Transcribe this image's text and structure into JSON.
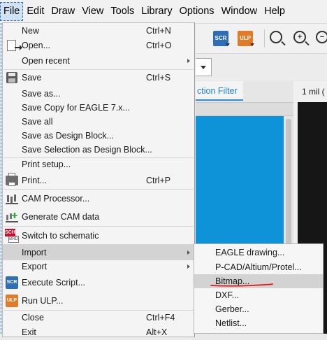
{
  "menubar": {
    "items": [
      "File",
      "Edit",
      "Draw",
      "View",
      "Tools",
      "Library",
      "Options",
      "Window",
      "Help"
    ],
    "active_index": 0
  },
  "toolbar": {
    "scr_icon_label": "SCR",
    "ulp_icon_label": "ULP",
    "zoom_icons": [
      "zoom-fit-icon",
      "zoom-in-icon",
      "zoom-out-icon"
    ]
  },
  "side_panel": {
    "tab_label": "ction Filter",
    "coordinate_readout": "1 mil ("
  },
  "file_menu": {
    "items": [
      {
        "label": "New",
        "shortcut": "Ctrl+N",
        "icon": ""
      },
      {
        "label": "Open...",
        "shortcut": "Ctrl+O",
        "icon": "open-file-icon"
      },
      {
        "label": "Open recent",
        "shortcut": "",
        "icon": "",
        "submenu": true
      },
      {
        "label": "Save",
        "shortcut": "Ctrl+S",
        "icon": "save-icon"
      },
      {
        "label": "Save as...",
        "shortcut": "",
        "icon": ""
      },
      {
        "label": "Save Copy for EAGLE 7.x...",
        "shortcut": "",
        "icon": ""
      },
      {
        "label": "Save all",
        "shortcut": "",
        "icon": ""
      },
      {
        "label": "Save as Design Block...",
        "shortcut": "",
        "icon": ""
      },
      {
        "label": "Save Selection as Design Block...",
        "shortcut": "",
        "icon": ""
      },
      {
        "label": "Print setup...",
        "shortcut": "",
        "icon": ""
      },
      {
        "label": "Print...",
        "shortcut": "Ctrl+P",
        "icon": "printer-icon"
      },
      {
        "label": "CAM Processor...",
        "shortcut": "",
        "icon": "cam-processor-icon"
      },
      {
        "label": "Generate CAM data",
        "shortcut": "",
        "icon": "generate-cam-icon"
      },
      {
        "label": "Switch to schematic",
        "shortcut": "",
        "icon": "sch-brd-icon"
      },
      {
        "label": "Import",
        "shortcut": "",
        "icon": "",
        "submenu": true
      },
      {
        "label": "Export",
        "shortcut": "",
        "icon": "",
        "submenu": true
      },
      {
        "label": "Execute Script...",
        "shortcut": "",
        "icon": "scr-icon"
      },
      {
        "label": "Run ULP...",
        "shortcut": "",
        "icon": "ulp-icon"
      },
      {
        "label": "Close",
        "shortcut": "Ctrl+F4",
        "icon": ""
      },
      {
        "label": "Exit",
        "shortcut": "Alt+X",
        "icon": ""
      }
    ],
    "icon_text": {
      "sch": "SCH",
      "brd": "BRD",
      "scr": "SCR",
      "ulp": "ULP"
    }
  },
  "import_submenu": {
    "items": [
      "EAGLE drawing...",
      "P-CAD/Altium/Protel...",
      "Bitmap...",
      "DXF...",
      "Gerber...",
      "Netlist..."
    ],
    "highlighted": "Bitmap..."
  },
  "colors": {
    "menu_bg": "#f4f4f4",
    "highlight": "#d3d3d3",
    "panel_blue": "#0f93d8",
    "annotation_red": "#e01b1b",
    "accent_tab": "#1a7fd0"
  }
}
